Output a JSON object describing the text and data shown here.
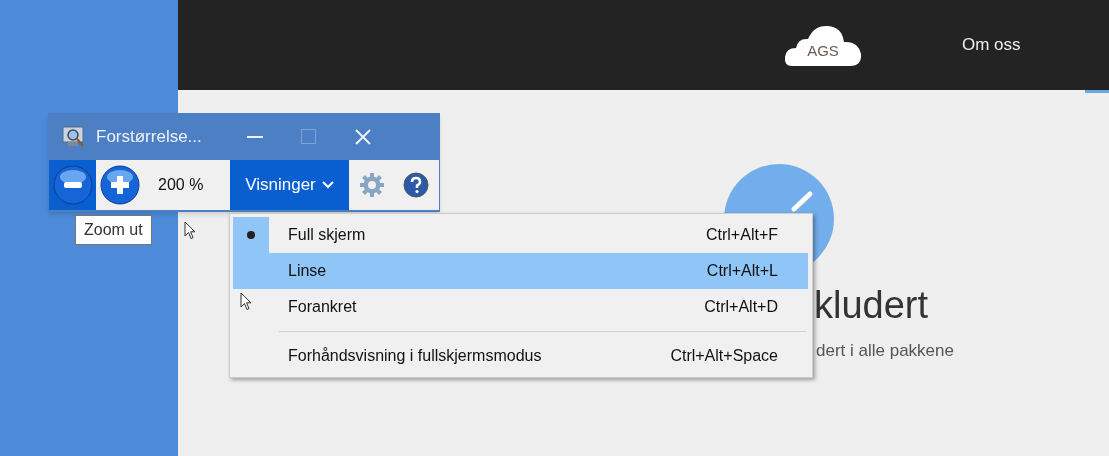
{
  "website": {
    "logo": "AGS",
    "nav": [
      {
        "label": "Om oss"
      }
    ],
    "heading": "kludert",
    "subtitle": "dert i alle pakkene"
  },
  "window": {
    "title": "Forstørrelse...",
    "zoom_level": "200 %",
    "views_button": "Visninger",
    "tooltip": "Zoom ut"
  },
  "views_menu": [
    {
      "kind": "item",
      "label": "Full skjerm",
      "shortcut": "Ctrl+Alt+F",
      "checked": true,
      "highlighted": false
    },
    {
      "kind": "item",
      "label": "Linse",
      "shortcut": "Ctrl+Alt+L",
      "checked": false,
      "highlighted": true
    },
    {
      "kind": "item",
      "label": "Forankret",
      "shortcut": "Ctrl+Alt+D",
      "checked": false,
      "highlighted": false
    },
    {
      "kind": "separator"
    },
    {
      "kind": "item",
      "label": "Forhåndsvisning i fullskjermsmodus",
      "shortcut": "Ctrl+Alt+Space",
      "checked": false,
      "highlighted": false
    }
  ]
}
